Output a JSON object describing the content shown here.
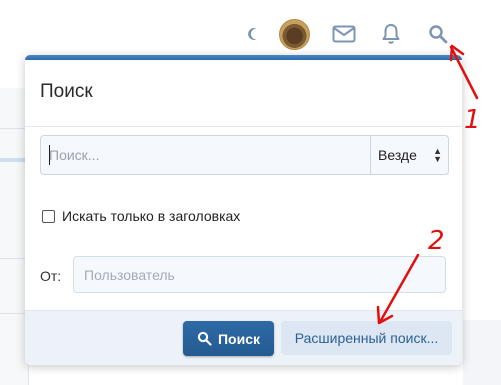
{
  "topnav": {
    "icons": [
      "moon-icon",
      "avatar",
      "mail-icon",
      "bell-icon",
      "search-icon"
    ]
  },
  "popup": {
    "title": "Поиск",
    "search_placeholder": "Поиск...",
    "scope_value": "Везде",
    "titles_only_label": "Искать только в заголовках",
    "from_label": "От:",
    "user_placeholder": "Пользователь",
    "search_button_label": "Поиск",
    "advanced_button_label": "Расширенный поиск..."
  },
  "annotations": {
    "label_1": "1",
    "label_2": "2",
    "color": "#e01010"
  },
  "colors": {
    "accent": "#3a78b8",
    "button_primary": "#2a63a0",
    "footer_bg": "#edf2f8"
  }
}
